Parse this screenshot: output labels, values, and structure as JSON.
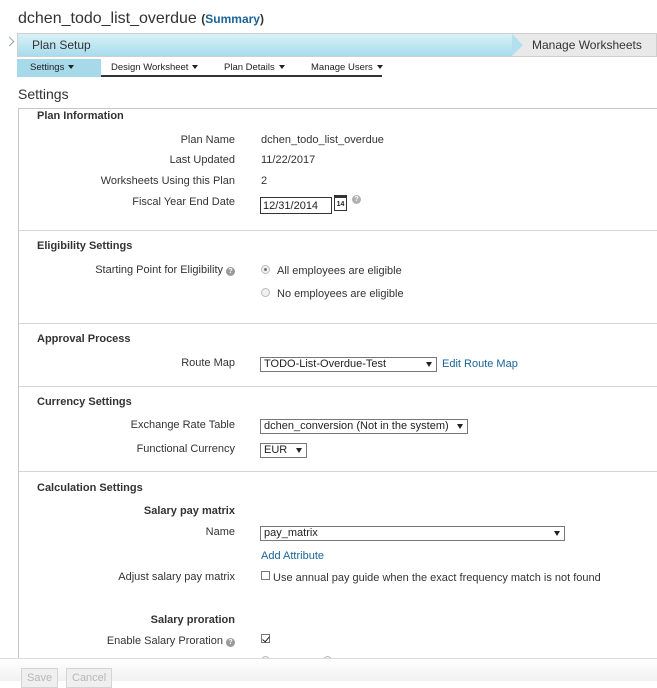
{
  "header": {
    "plan_name": "dchen_todo_list_overdue",
    "summary_open": "(",
    "summary_link": "Summary",
    "summary_close": ")"
  },
  "wizard": {
    "steps": [
      {
        "label": "Plan Setup",
        "active": true
      },
      {
        "label": "Manage Worksheets",
        "active": false
      }
    ]
  },
  "subnav": {
    "items": [
      {
        "label": "Settings",
        "active": true
      },
      {
        "label": "Design Worksheet",
        "active": false
      },
      {
        "label": "Plan Details",
        "active": false
      },
      {
        "label": "Manage Users",
        "active": false
      }
    ]
  },
  "page_heading": "Settings",
  "plan_info": {
    "title": "Plan Information",
    "plan_name_label": "Plan Name",
    "plan_name_value": "dchen_todo_list_overdue",
    "last_updated_label": "Last Updated",
    "last_updated_value": "11/22/2017",
    "worksheets_label": "Worksheets Using this Plan",
    "worksheets_value": "2",
    "fiscal_label": "Fiscal Year End Date",
    "fiscal_value": "12/31/2014",
    "calendar_day": "14",
    "help_glyph": "?"
  },
  "eligibility": {
    "title": "Eligibility Settings",
    "label": "Starting Point for Eligibility",
    "help_glyph": "?",
    "options": [
      {
        "label": "All employees are eligible",
        "selected": true
      },
      {
        "label": "No employees are eligible",
        "selected": false
      }
    ]
  },
  "approval": {
    "title": "Approval Process",
    "route_map_label": "Route Map",
    "route_map_value": "TODO-List-Overdue-Test",
    "edit_link": "Edit Route Map"
  },
  "currency": {
    "title": "Currency Settings",
    "exchange_label": "Exchange Rate Table",
    "exchange_value": "dchen_conversion (Not in the system)",
    "functional_label": "Functional Currency",
    "functional_value": "EUR"
  },
  "calculation": {
    "title": "Calculation Settings",
    "matrix_heading": "Salary pay matrix",
    "name_label": "Name",
    "name_value": "pay_matrix",
    "add_attribute": "Add Attribute",
    "adjust_label": "Adjust salary pay matrix",
    "adjust_checkbox_label": "Use annual pay guide when the exact frequency match is not found",
    "adjust_checked": false,
    "proration_heading": "Salary proration",
    "enable_label": "Enable Salary Proration",
    "enable_checked": true,
    "help_glyph": "?"
  },
  "footer": {
    "save_label": "Save",
    "cancel_label": "Cancel"
  },
  "colors": {
    "accent": "#a6daea",
    "link": "#1a6496",
    "text": "#333333"
  }
}
